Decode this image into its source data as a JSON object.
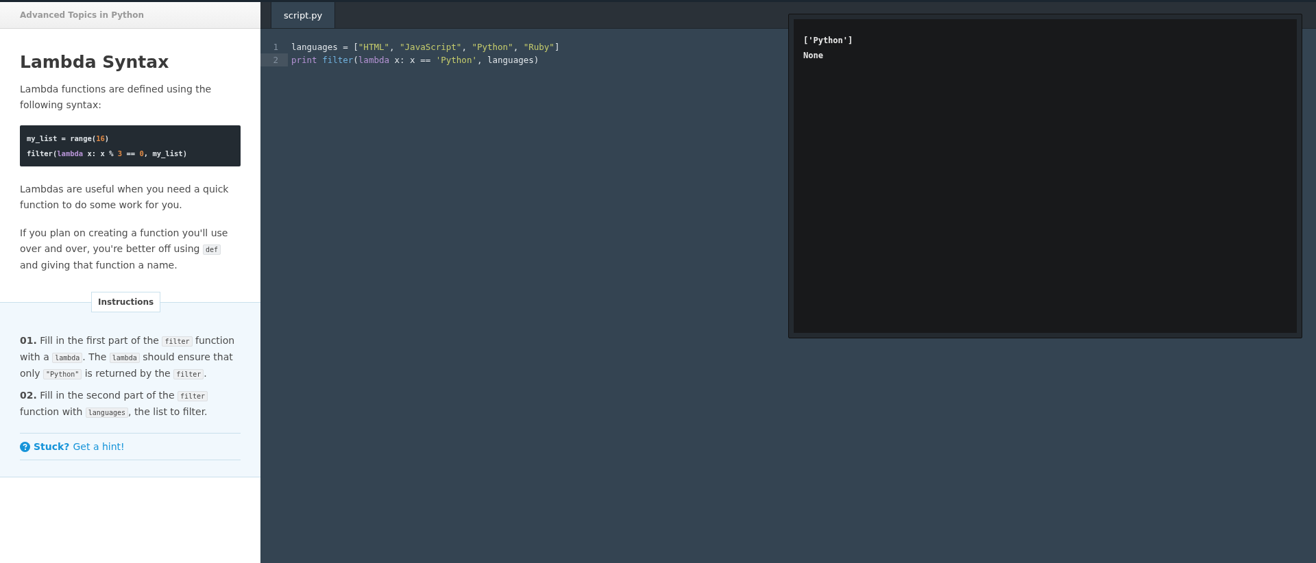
{
  "course_header": {
    "title": "Advanced Topics in Python"
  },
  "lesson": {
    "title": "Lambda Syntax",
    "paragraphs_before": [
      [
        {
          "kind": "text",
          "text": "Lambda functions are defined using the following syntax:"
        }
      ]
    ],
    "code_snippet": [
      [
        {
          "kind": "plain",
          "text": "my_list = range("
        },
        {
          "kind": "number",
          "text": "16"
        },
        {
          "kind": "plain",
          "text": ")"
        }
      ],
      [
        {
          "kind": "plain",
          "text": "filter("
        },
        {
          "kind": "keyword",
          "text": "lambda"
        },
        {
          "kind": "plain",
          "text": " x: x % "
        },
        {
          "kind": "number",
          "text": "3"
        },
        {
          "kind": "plain",
          "text": " == "
        },
        {
          "kind": "number",
          "text": "0"
        },
        {
          "kind": "plain",
          "text": ", my_list)"
        }
      ]
    ],
    "paragraphs_after": [
      [
        {
          "kind": "text",
          "text": "Lambdas are useful when you need a quick function to do some work for you."
        }
      ],
      [
        {
          "kind": "text",
          "text": "If you plan on creating a function you'll use over and over, you're better off using "
        },
        {
          "kind": "code",
          "text": "def"
        },
        {
          "kind": "text",
          "text": " and giving that function a name."
        }
      ]
    ]
  },
  "instructions": {
    "label": "Instructions",
    "steps": [
      [
        {
          "kind": "text",
          "text": "**01.** Fill in the first part of the "
        },
        {
          "kind": "code",
          "text": "filter"
        },
        {
          "kind": "text",
          "text": " function with a "
        },
        {
          "kind": "code",
          "text": "lambda"
        },
        {
          "kind": "text",
          "text": ". The "
        },
        {
          "kind": "code",
          "text": "lambda"
        },
        {
          "kind": "text",
          "text": " should ensure that only "
        },
        {
          "kind": "code",
          "text": "\"Python\""
        },
        {
          "kind": "text",
          "text": " is returned by the "
        },
        {
          "kind": "code",
          "text": "filter"
        },
        {
          "kind": "text",
          "text": "."
        }
      ],
      [
        {
          "kind": "text",
          "text": "**02.** Fill in the second part of the "
        },
        {
          "kind": "code",
          "text": "filter"
        },
        {
          "kind": "text",
          "text": " function with "
        },
        {
          "kind": "code",
          "text": "languages"
        },
        {
          "kind": "text",
          "text": ", the list to filter."
        }
      ]
    ],
    "hint": {
      "prompt": "Stuck?",
      "link": "Get a hint!"
    }
  },
  "editor": {
    "tabs": [
      {
        "label": "script.py",
        "selected": true
      }
    ],
    "lines": [
      {
        "number": "1",
        "active": false,
        "tokens": [
          {
            "kind": "plain",
            "text": "languages = ["
          },
          {
            "kind": "string",
            "text": "\"HTML\""
          },
          {
            "kind": "plain",
            "text": ", "
          },
          {
            "kind": "string",
            "text": "\"JavaScript\""
          },
          {
            "kind": "plain",
            "text": ", "
          },
          {
            "kind": "string",
            "text": "\"Python\""
          },
          {
            "kind": "plain",
            "text": ", "
          },
          {
            "kind": "string",
            "text": "\"Ruby\""
          },
          {
            "kind": "plain",
            "text": "]"
          }
        ]
      },
      {
        "number": "2",
        "active": true,
        "tokens": [
          {
            "kind": "keyword",
            "text": "print "
          },
          {
            "kind": "builtin",
            "text": "filter"
          },
          {
            "kind": "plain",
            "text": "("
          },
          {
            "kind": "keyword",
            "text": "lambda"
          },
          {
            "kind": "plain",
            "text": " x: x == "
          },
          {
            "kind": "string",
            "text": "'Python'"
          },
          {
            "kind": "plain",
            "text": ", languages)"
          }
        ]
      }
    ]
  },
  "output": {
    "lines": [
      "['Python']",
      "None"
    ]
  }
}
